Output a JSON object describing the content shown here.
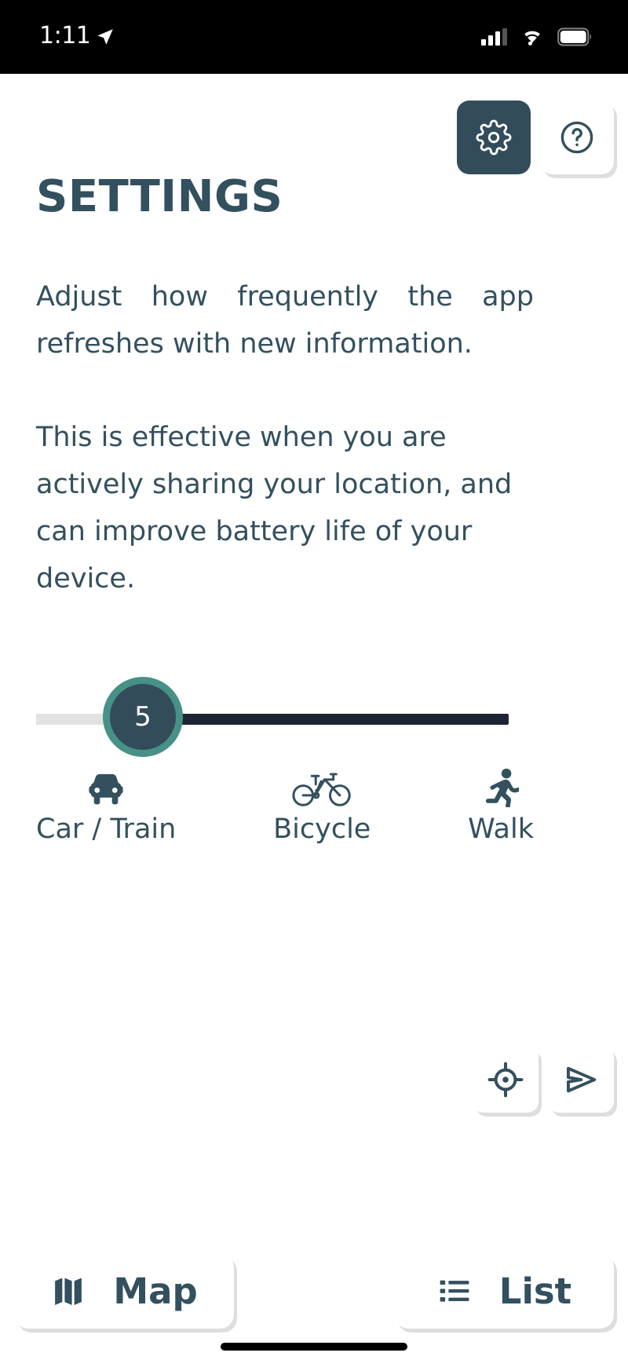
{
  "statusbar": {
    "time": "1:11",
    "location_arrow_icon": "location-arrow-icon",
    "cellular_icon": "cellular-signal-icon",
    "wifi_icon": "wifi-icon",
    "battery_icon": "battery-icon"
  },
  "header": {
    "settings_button_label": "settings-gear",
    "settings_icon": "gear-icon",
    "help_button_label": "help",
    "help_icon": "question-mark-circle-icon",
    "title": "SETTINGS"
  },
  "body": {
    "paragraph_1": "Adjust how frequently the app refreshes with new information.",
    "paragraph_2": "This is effective when you are actively sharing your location, and can improve battery life of your device."
  },
  "slider": {
    "value": "5",
    "min": 0,
    "max": 30,
    "thumb_ring_color": "#479187",
    "thumb_fill_color": "#334c5a",
    "track_color": "#1d2535",
    "filled_color": "#e2e2e2"
  },
  "modes": [
    {
      "label": "Car / Train",
      "icon": "car-icon"
    },
    {
      "label": "Bicycle",
      "icon": "bicycle-icon"
    },
    {
      "label": "Walk",
      "icon": "walking-person-icon"
    }
  ],
  "fabs": [
    {
      "name": "locate-me",
      "icon": "crosshair-target-icon"
    },
    {
      "name": "share-location",
      "icon": "send-arrow-icon"
    }
  ],
  "bottom_nav": [
    {
      "label": "Map",
      "icon": "folded-map-icon"
    },
    {
      "label": "List",
      "icon": "bullet-list-icon"
    }
  ],
  "colors": {
    "text": "#33505e",
    "accent": "#479187",
    "dark": "#334c5a",
    "track": "#1d2535"
  }
}
